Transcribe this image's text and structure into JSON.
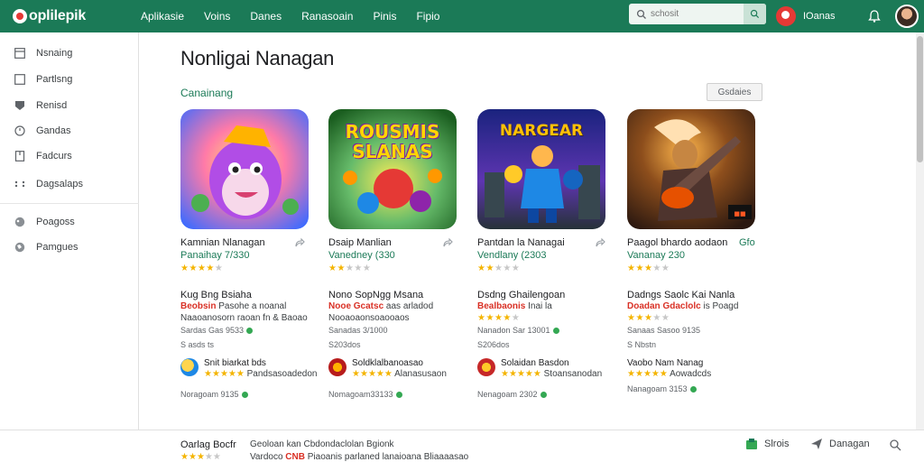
{
  "header": {
    "logo": "oplilepik",
    "nav": [
      "Aplikasie",
      "Voins",
      "Danes",
      "Ranasoain",
      "Pinis",
      "Fipio"
    ],
    "search_placeholder": "schosit",
    "user_name": "IOanas"
  },
  "sidebar": {
    "items": [
      {
        "label": "Nsnaing",
        "icon": "grid-icon"
      },
      {
        "label": "Partlsng",
        "icon": "square-icon"
      },
      {
        "label": "Renisd",
        "icon": "shield-icon"
      },
      {
        "label": "Gandas",
        "icon": "circle-clock-icon"
      },
      {
        "label": "Fadcurs",
        "icon": "document-icon"
      },
      {
        "label": "Dagsalaps",
        "icon": "dots-icon"
      },
      {
        "label": "Poagoss",
        "icon": "chat-icon"
      },
      {
        "label": "Pamgues",
        "icon": "globe-icon"
      }
    ]
  },
  "main": {
    "title": "Nonligai Nanagan",
    "section": "Canainang",
    "details_button": "Gsdaies",
    "cards": [
      {
        "art_text": "",
        "app_title": "Kamnian Nlanagan",
        "price": "Panaihay 7/330",
        "rating": 4,
        "name2": "Kug Bng Bsiaha",
        "red_label": "Beobsin",
        "red_rest": "Pasohe a noanal",
        "desc": "Naaoanosorn raoan fn & Baoao",
        "meta1": "Sardas Gas 9533",
        "meta2": "S asds ts",
        "sub_title": "Snit biarkat bds",
        "sub_line2": "Pandsasoadedon",
        "sub_rating": 2,
        "meta3": "Noragoam 9135"
      },
      {
        "art_text": "ROUSMIS SLANAS",
        "app_title": "Dsaip Manlian",
        "price": "Vanedney (330",
        "rating": 2,
        "name2": "Nono SopNgg Msana",
        "red_label": "Nooe Gcatsc",
        "red_rest": "aas arladod",
        "desc": "Nooaoaonsoaooaos",
        "meta1": "Sanadas 3/1000",
        "meta2": "S203dos",
        "sub_title": "Soldklalbanoasao",
        "sub_line2": "Alanasusaon",
        "sub_rating": 4,
        "meta3": "Nomagoam33133"
      },
      {
        "art_text": "NARGEAR",
        "app_title": "Pantdan la Nanagai",
        "price": "Vendlany (2303",
        "rating": 2,
        "name2": "Dsdng Ghailengoan",
        "red_label": "Bealbaonis",
        "red_rest": "Inai la",
        "desc": "",
        "meta1": "Nanadon Sar 13001",
        "meta2": "S206dos",
        "sub_title": "Solaidan Basdon",
        "sub_line2": "Stoansanodan",
        "sub_rating": 4,
        "meta3": "Nenagoam 2302"
      },
      {
        "art_text": "",
        "app_title": "Paagol bhardo aodaon",
        "price": "Vananay 230",
        "rating": 3,
        "name2": "Dadngs Saolc Kai Nanla",
        "red_label": "Doadan Gdaclolc",
        "red_rest": "is Poagd",
        "desc": "",
        "meta1": "Sanaas Sasoo 9135",
        "meta2": "S Nbstn",
        "sub_title": "Vaobo Nam Nanag",
        "sub_line2": "Aowadcds",
        "sub_rating": 4,
        "meta3": "Nanagoam 3153",
        "share_label": "Gfo"
      }
    ]
  },
  "bottom": {
    "title": "Oarlag Bocfr",
    "text1": "Geoloan kan Cbdondaclolan Bgionk",
    "rating": 3,
    "line2_pre": "Vardoco",
    "line2_red": "CNB",
    "line2_post": "Piaoanis parlaned lanaioana Bliaaaasao",
    "action1": "Slrois",
    "action2": "Danagan"
  },
  "colors": {
    "brand": "#1b7a57",
    "accent_red": "#d93025",
    "star": "#f4b400"
  }
}
